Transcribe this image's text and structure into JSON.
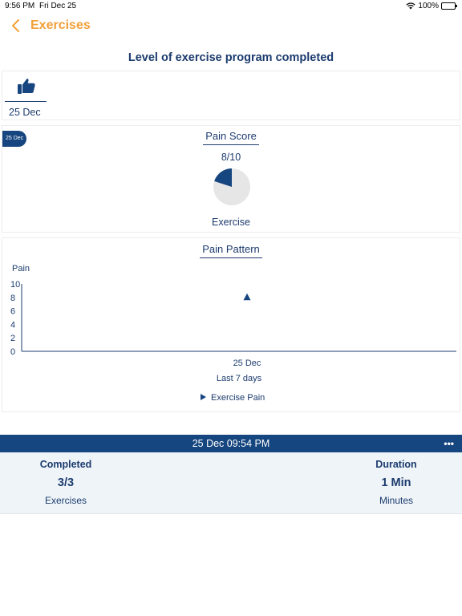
{
  "status_bar": {
    "time": "9:56 PM",
    "date": "Fri Dec 25",
    "battery": "100%"
  },
  "nav": {
    "back_label": "Exercises"
  },
  "page_title": "Level of exercise program completed",
  "level_card": {
    "icon": "thumbs-up-icon",
    "date": "25 Dec"
  },
  "pain_score": {
    "tag": "25 Dec",
    "title": "Pain Score",
    "value": "8/10",
    "fraction": 0.8,
    "caption": "Exercise"
  },
  "pain_pattern": {
    "title": "Pain Pattern",
    "chart_data": {
      "type": "scatter",
      "title": "Pain Pattern",
      "ylabel": "Pain",
      "xlabel": "Last 7 days",
      "ylim": [
        0,
        10
      ],
      "yticks": [
        0,
        2,
        4,
        6,
        8,
        10
      ],
      "categories": [
        "25 Dec"
      ],
      "series": [
        {
          "name": "Exercise Pain",
          "marker": "triangle",
          "values": [
            8
          ]
        }
      ],
      "legend": "bottom-center"
    }
  },
  "session": {
    "datetime": "25 Dec 09:54 PM",
    "completed_label": "Completed",
    "completed_value": "3/3",
    "completed_unit": "Exercises",
    "duration_label": "Duration",
    "duration_value": "1 Min",
    "duration_unit": "Minutes"
  },
  "colors": {
    "accent": "#f3a03a",
    "primary": "#1c3b6e",
    "header_bar": "#16467f",
    "pie_fill": "#16467f",
    "pie_rest": "#e6e6e6"
  }
}
